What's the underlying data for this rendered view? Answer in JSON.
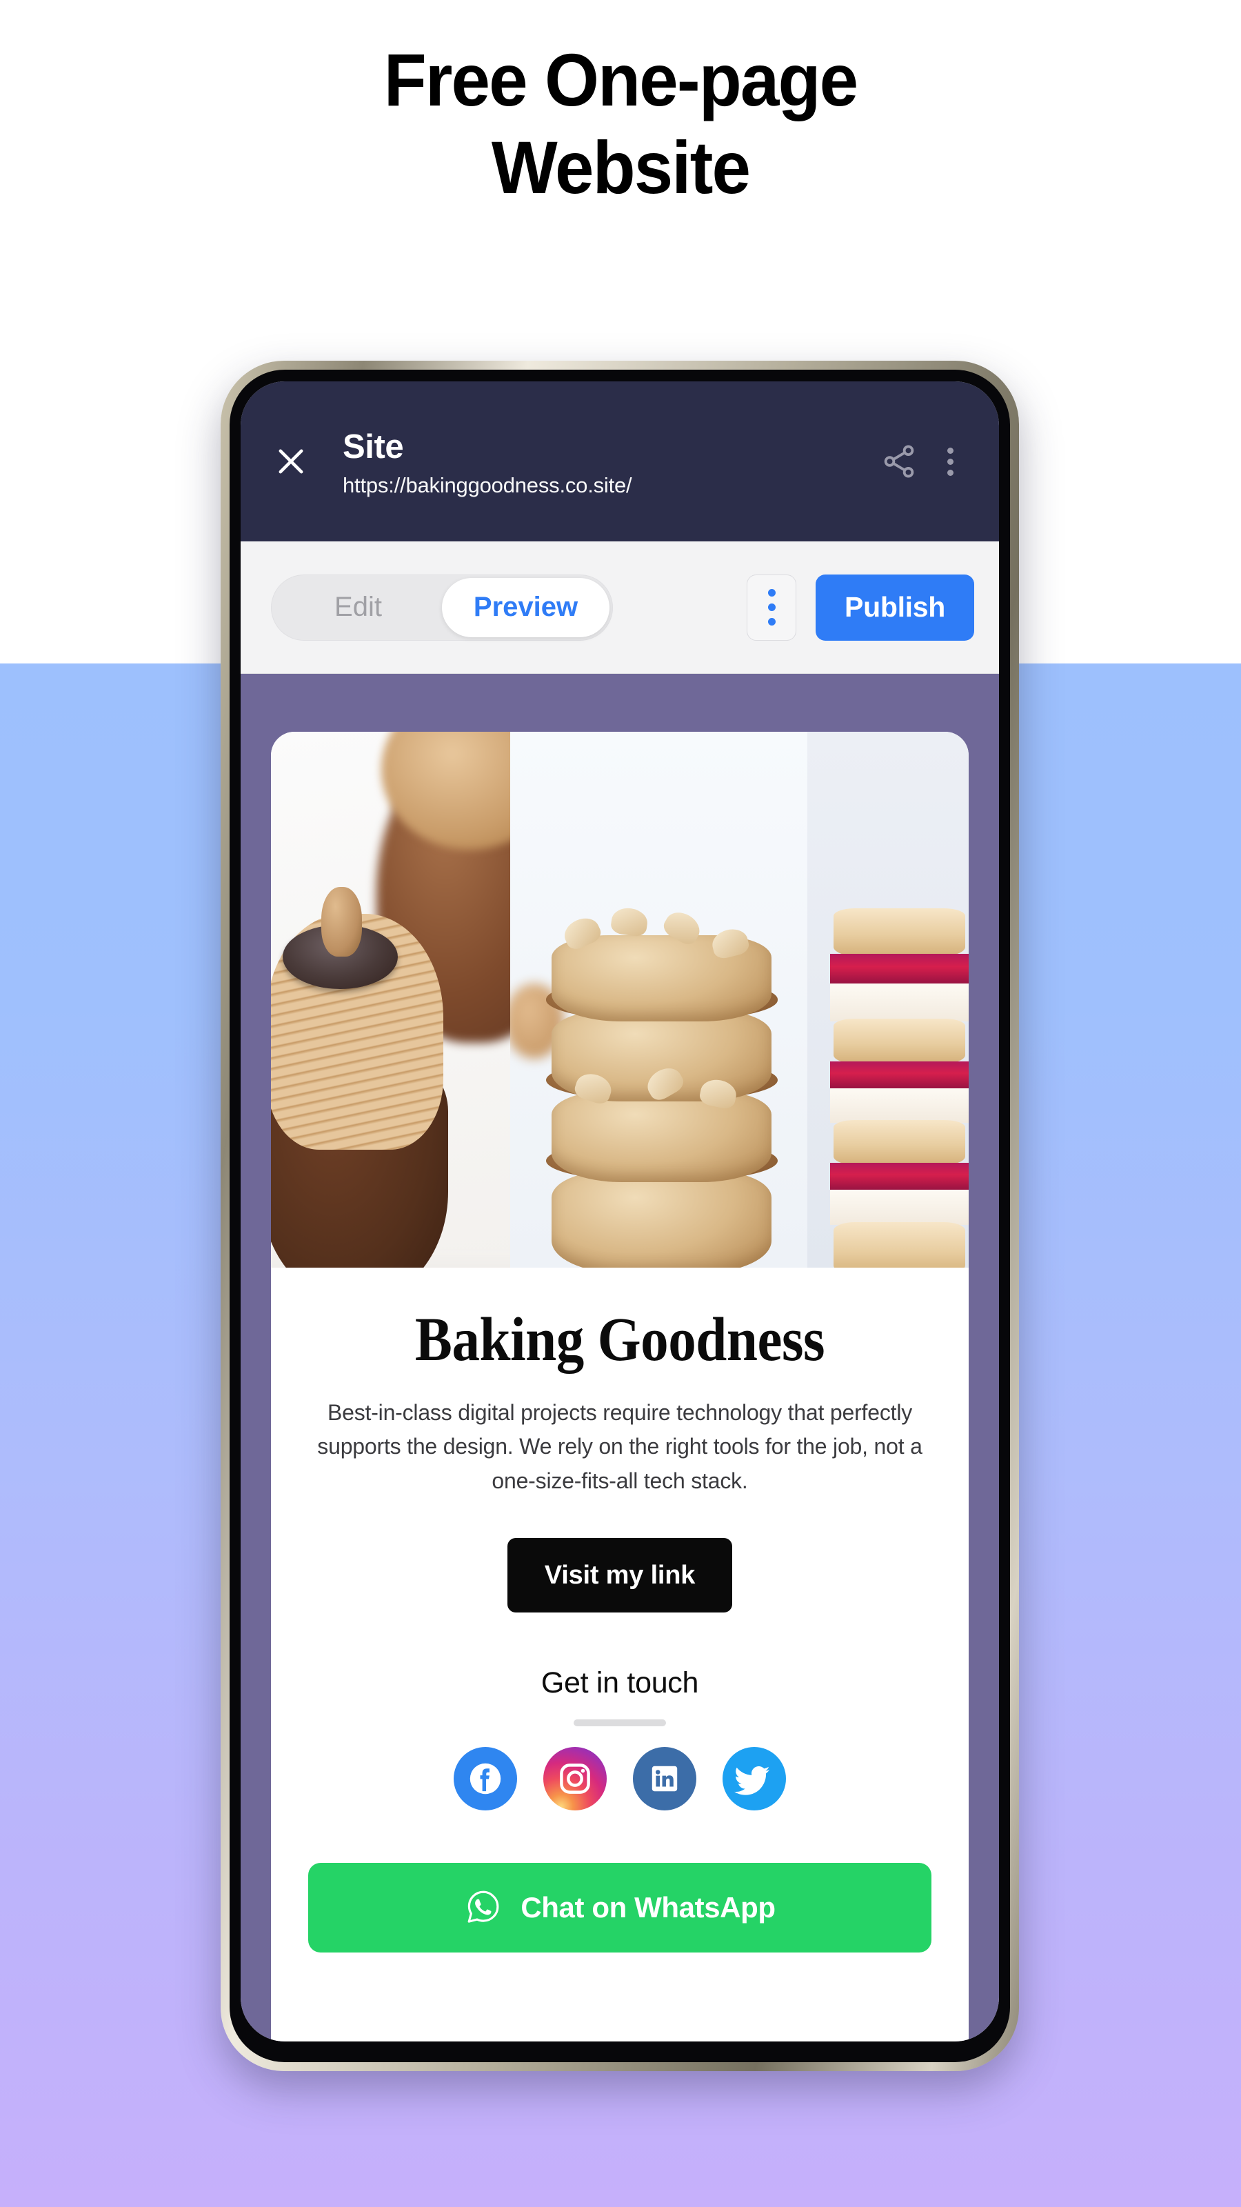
{
  "promo": {
    "headline": "Free One-page\nWebsite"
  },
  "colors": {
    "page_bg_top": "#ffffff",
    "page_bg_gradient_start": "#9dc0fd",
    "page_bg_gradient_end": "#c6b0fb",
    "appbar_bg": "#2b2d49",
    "toolbar_bg": "#f3f3f4",
    "accent_blue": "#2f7cf6",
    "preview_band": "#6f6898",
    "cta_black": "#0a0a0a",
    "whatsapp_green": "#25d366",
    "facebook_blue": "#2f86f0",
    "linkedin_blue": "#3c6da8",
    "twitter_blue": "#1da1f2"
  },
  "appbar": {
    "close_icon": "close-icon",
    "title": "Site",
    "url": "https://bakinggoodness.co.site/",
    "share_icon": "share-icon",
    "overflow_icon": "more-vertical-icon"
  },
  "toolbar": {
    "modes": [
      {
        "label": "Edit",
        "active": false
      },
      {
        "label": "Preview",
        "active": true
      }
    ],
    "overflow_icon": "more-vertical-icon",
    "publish_label": "Publish"
  },
  "site": {
    "hero": {
      "panels": [
        "hazelnut-praline-cupcake-photo",
        "almond-caramel-cookie-stack-photo",
        "raspberry-cream-sandwich-biscuit-photo"
      ]
    },
    "brand_title": "Baking Goodness",
    "tagline": "Best-in-class digital projects require technology that perfectly supports the design. We rely on the right tools for the job, not a one-size-fits-all tech stack.",
    "primary_cta": "Visit my link",
    "contact_heading": "Get in touch",
    "socials": [
      {
        "name": "facebook",
        "label": "Facebook"
      },
      {
        "name": "instagram",
        "label": "Instagram"
      },
      {
        "name": "linkedin",
        "label": "LinkedIn"
      },
      {
        "name": "twitter",
        "label": "Twitter"
      }
    ],
    "whatsapp_cta": "Chat on WhatsApp",
    "whatsapp_icon": "whatsapp-icon"
  }
}
